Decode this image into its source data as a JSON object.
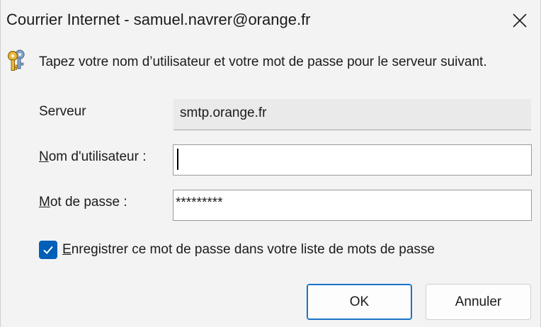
{
  "window": {
    "title": "Courrier Internet - samuel.navrer@orange.fr",
    "close_icon": "close-x-icon"
  },
  "prompt": {
    "icon": "keys-icon",
    "text": "Tapez votre nom d’utilisateur et votre mot de passe pour le serveur suivant."
  },
  "server": {
    "label": "Serveur",
    "value": "smtp.orange.fr"
  },
  "username": {
    "label_access": "N",
    "label_rest": "om d'utilisateur :",
    "value": ""
  },
  "password": {
    "label_access": "M",
    "label_rest": "ot de passe :",
    "masked_value": "*********"
  },
  "remember": {
    "checked": true,
    "label_access": "E",
    "label_rest": "nregistrer ce mot de passe dans votre liste de mots de passe"
  },
  "buttons": {
    "ok": "OK",
    "cancel": "Annuler"
  },
  "colors": {
    "accent": "#005fb8",
    "background": "#f3f3f3"
  }
}
